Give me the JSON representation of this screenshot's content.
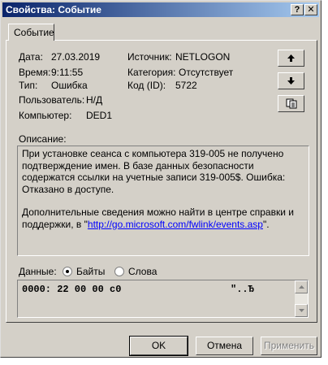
{
  "window": {
    "title": "Свойства: Событие",
    "help_glyph": "?",
    "close_glyph": "✕"
  },
  "tabs": [
    {
      "label": "Событие",
      "selected": true
    }
  ],
  "fields": {
    "date_label": "Дата:",
    "date_value": "27.03.2019",
    "time_label": "Время:",
    "time_value": "9:11:55",
    "type_label": "Тип:",
    "type_value": "Ошибка",
    "user_label": "Пользователь:",
    "user_value": "Н/Д",
    "computer_label": "Компьютер:",
    "computer_value": "DED1",
    "source_label": "Источник:",
    "source_value": "NETLOGON",
    "category_label": "Категория:",
    "category_value": "Отсутствует",
    "code_label": "Код (ID):",
    "code_value": "5722"
  },
  "nav": {
    "up_icon": "arrow-up-icon",
    "down_icon": "arrow-down-icon",
    "copy_icon": "copy-icon"
  },
  "description": {
    "label": "Описание:",
    "para1": "При установке сеанса с компьютера 319-005 не получено подтверждение имен. В базе данных безопасности содержатся ссылки на учетные записи 319-005$.  Ошибка:",
    "para1_line2": "Отказано в доступе.",
    "para2_prefix": "Дополнительные сведения можно найти в центре справки и поддержки, в \"",
    "para2_link": "http://go.microsoft.com/fwlink/events.asp",
    "para2_suffix": "\"."
  },
  "data_section": {
    "label": "Данные:",
    "options": [
      "Байты",
      "Слова"
    ],
    "selected": "Байты",
    "hex_line": "0000: 22 00 00 c0",
    "ascii_line": "\"..Ђ"
  },
  "buttons": {
    "ok": "OK",
    "cancel": "Отмена",
    "apply": "Применить"
  }
}
